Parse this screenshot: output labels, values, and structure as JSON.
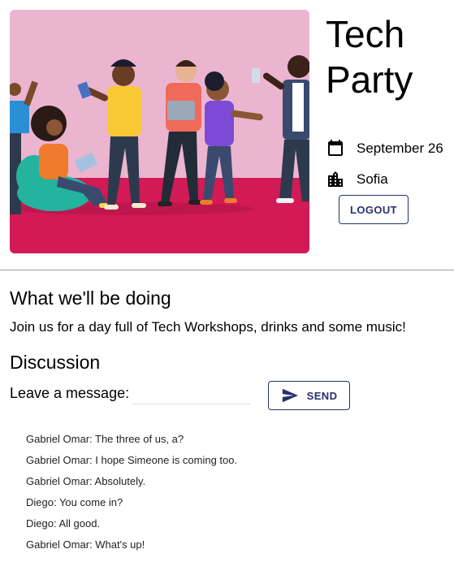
{
  "event": {
    "title": "Tech Party",
    "date": "September 26",
    "location": "Sofia",
    "date_icon": "calendar-icon",
    "location_icon": "city-icon"
  },
  "auth": {
    "logout_label": "LOGOUT"
  },
  "about": {
    "heading": "What we'll be doing",
    "description": "Join us for a day full of Tech Workshops, drinks and some music!"
  },
  "discussion": {
    "heading": "Discussion",
    "message_label": "Leave a message:",
    "message_value": "",
    "send_label": "SEND",
    "send_icon": "send-icon",
    "messages": [
      {
        "text": "Gabriel Omar: The three of us, a?"
      },
      {
        "text": "Gabriel Omar: I hope Simeone is coming too."
      },
      {
        "text": "Gabriel Omar: Absolutely."
      },
      {
        "text": "Diego: You come in?"
      },
      {
        "text": "Diego: All good."
      },
      {
        "text": "Gabriel Omar: What's up!"
      }
    ]
  },
  "colors": {
    "accent": "#28306e",
    "hero_background": "#ebb5d0",
    "hero_floor": "#d11a56"
  }
}
